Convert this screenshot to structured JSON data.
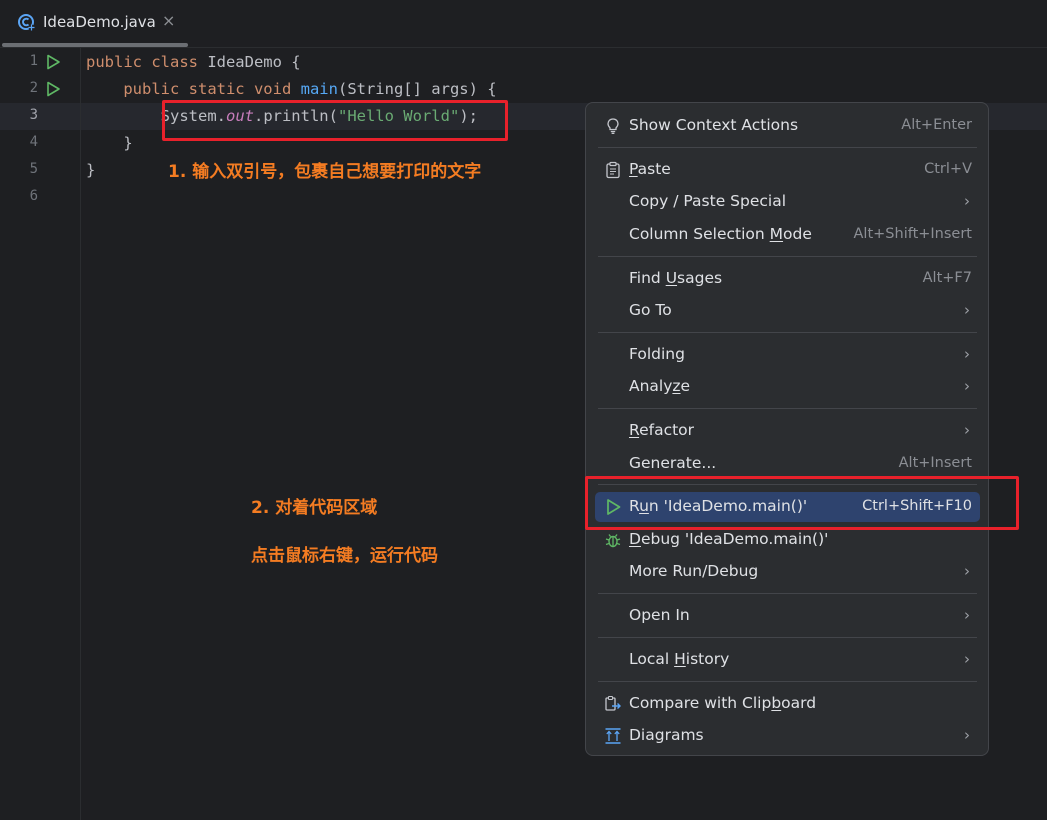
{
  "tab": {
    "title": "IdeaDemo.java",
    "close": "×"
  },
  "lines": [
    {
      "no": "1"
    },
    {
      "no": "2"
    },
    {
      "no": "3"
    },
    {
      "no": "4"
    },
    {
      "no": "5"
    },
    {
      "no": "6"
    }
  ],
  "code": {
    "l1": {
      "kw": "public class",
      "name": " IdeaDemo {"
    },
    "l2": {
      "kw": "    public static void",
      "fn": " main",
      "rest": "(String[] args) {"
    },
    "l3": {
      "pre": "        System.",
      "fld": "out",
      "mid": ".println(",
      "str": "\"Hello World\"",
      "end": ");"
    },
    "l4": "    }",
    "l5": "}"
  },
  "annotations": {
    "step1": "1. 输入双引号，包裹自己想要打印的文字",
    "step2": "2. 对着代码区域",
    "step2b": "点击鼠标右键，运行代码"
  },
  "menu": {
    "show_context_actions": {
      "label": "Show Context Actions",
      "shortcut": "Alt+Enter"
    },
    "paste": {
      "label_u": "P",
      "label_rest": "aste",
      "shortcut": "Ctrl+V"
    },
    "copy_paste_special": {
      "label": "Copy / Paste Special"
    },
    "column_selection": {
      "label_pre": "Column Selection ",
      "label_u": "M",
      "label_rest": "ode",
      "shortcut": "Alt+Shift+Insert"
    },
    "find_usages": {
      "label_pre": "Find ",
      "label_u": "U",
      "label_rest": "sages",
      "shortcut": "Alt+F7"
    },
    "go_to": {
      "label": "Go To"
    },
    "folding": {
      "label": "Folding"
    },
    "analyze": {
      "label_pre": "Analy",
      "label_u": "z",
      "label_rest": "e"
    },
    "refactor": {
      "label_u": "R",
      "label_rest": "efactor"
    },
    "generate": {
      "label": "Generate...",
      "shortcut": "Alt+Insert"
    },
    "run": {
      "label_pre": "R",
      "label_u": "u",
      "label_rest": "n 'IdeaDemo.main()'",
      "shortcut": "Ctrl+Shift+F10"
    },
    "debug": {
      "label_u": "D",
      "label_rest": "ebug 'IdeaDemo.main()'"
    },
    "more_run_debug": {
      "label": "More Run/Debug"
    },
    "open_in": {
      "label": "Open In"
    },
    "local_history": {
      "label_pre": "Local ",
      "label_u": "H",
      "label_rest": "istory"
    },
    "compare_clipboard": {
      "label_pre": "Compare with Clip",
      "label_u": "b",
      "label_rest": "oard"
    },
    "diagrams": {
      "label": "Diagrams"
    },
    "submenu_arrow": "›"
  },
  "colors": {
    "accent_red": "#e8212b",
    "annotation_orange": "#f47c22",
    "highlight": "#2e436e"
  }
}
